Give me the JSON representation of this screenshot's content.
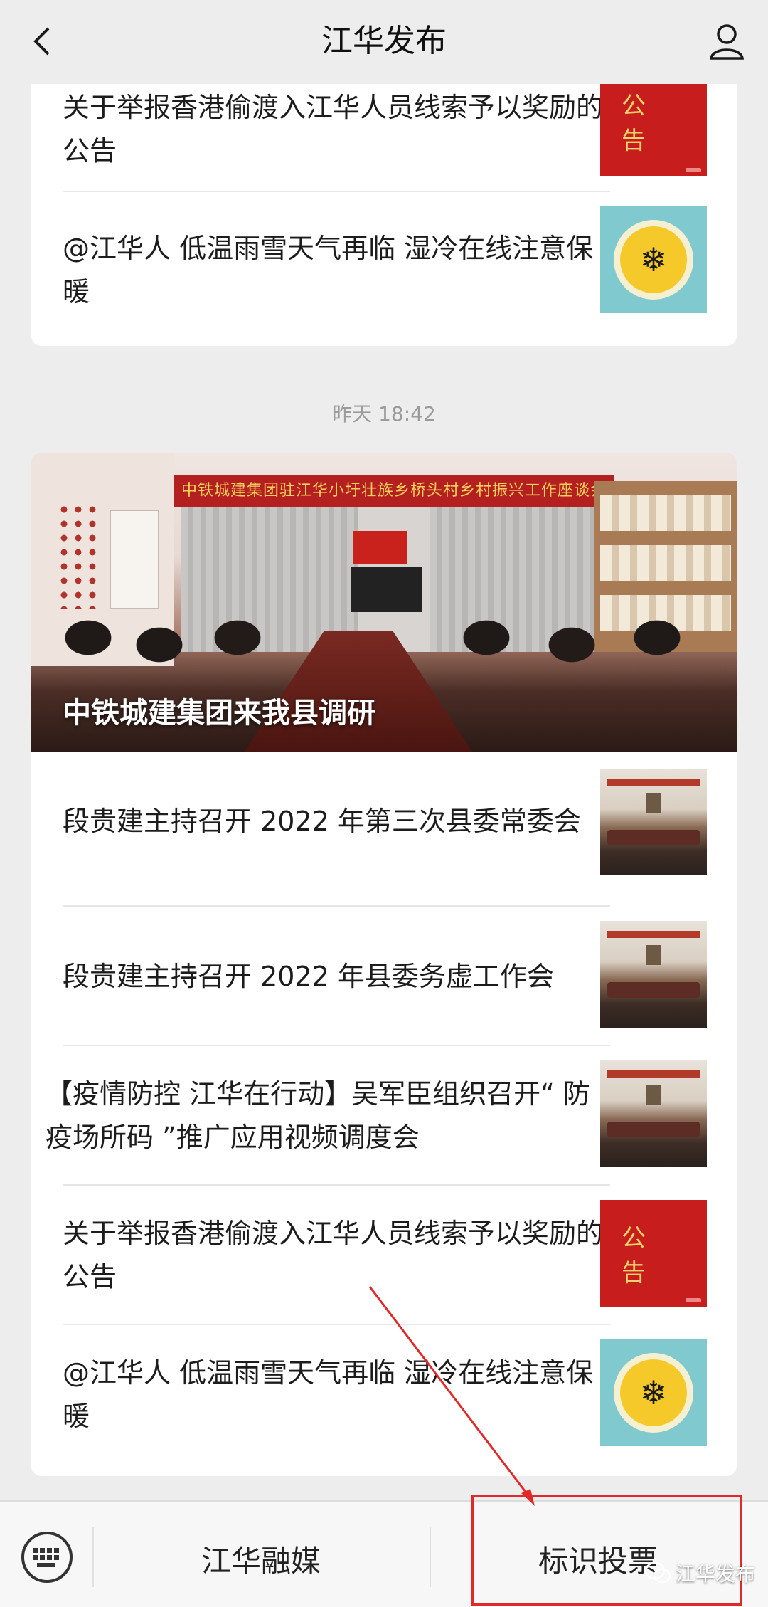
{
  "header": {
    "title": "江华发布"
  },
  "top_card": {
    "items": [
      {
        "text": "关于举报香港偷渡入江华人员线索予以奖励的公告",
        "thumb": "notice"
      },
      {
        "text": "@江华人 低温雨雪天气再临  湿冷在线注意保暖",
        "thumb": "snowflake"
      }
    ]
  },
  "timestamp": "昨天 18:42",
  "main_card": {
    "hero_caption": "中铁城建集团来我县调研",
    "hero_banner": "中铁城建集团驻江华小圩壮族乡桥头村乡村振兴工作座谈会",
    "items": [
      {
        "text": "段贵建主持召开 2022 年第三次县委常委会",
        "thumb": "meeting"
      },
      {
        "text": "段贵建主持召开 2022 年县委务虚工作会",
        "thumb": "meeting"
      },
      {
        "text": "【疫情防控 江华在行动】吴军臣组织召开“ 防疫场所码 ”推广应用视频调度会",
        "thumb": "meeting"
      },
      {
        "text": "关于举报香港偷渡入江华人员线索予以奖励的公告",
        "thumb": "notice"
      },
      {
        "text": "@江华人 低温雨雪天气再临  湿冷在线注意保暖",
        "thumb": "snowflake"
      }
    ]
  },
  "notice_thumb_text": "公告",
  "bottom_bar": {
    "menu1": "江华融媒",
    "menu2": "标识投票"
  },
  "watermark": "江华发布",
  "colors": {
    "highlight": "#e02a2a",
    "notice_bg": "#c81d1d"
  }
}
